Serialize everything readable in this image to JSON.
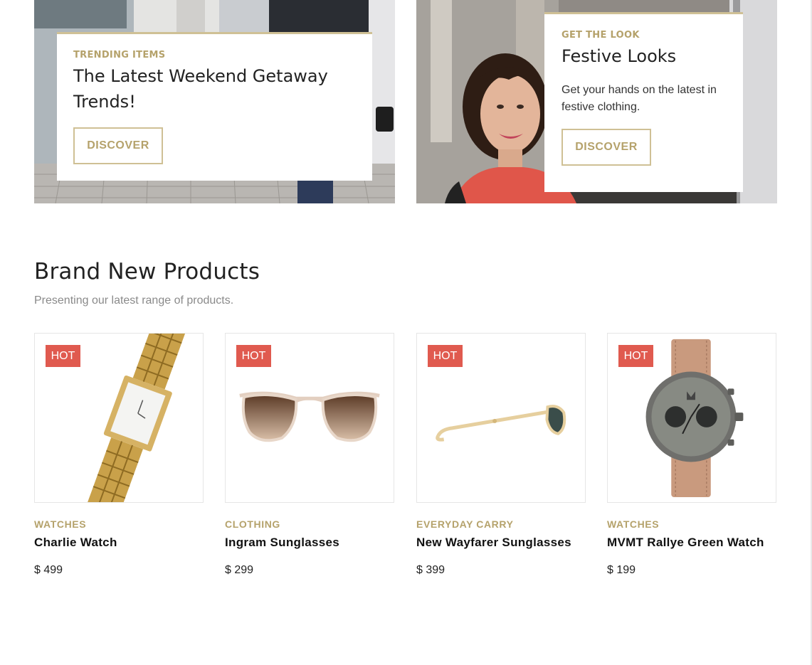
{
  "banners": [
    {
      "eyebrow": "TRENDING ITEMS",
      "title_line1": "The Latest Weekend Getaway",
      "title_line2": "Trends!",
      "description": "",
      "button": "DISCOVER"
    },
    {
      "eyebrow": "GET THE LOOK",
      "title_line1": "Festive Looks",
      "title_line2": "",
      "description": "Get your hands on the latest in festive clothing.",
      "button": "DISCOVER"
    }
  ],
  "section": {
    "title": "Brand New Products",
    "subtitle": "Presenting our latest range of products."
  },
  "products": [
    {
      "badge": "HOT",
      "category": "WATCHES",
      "name": "Charlie Watch",
      "price": "$ 499",
      "image_icon": "gold-watch-image"
    },
    {
      "badge": "HOT",
      "category": "CLOTHING",
      "name": "Ingram Sunglasses",
      "price": "$ 299",
      "image_icon": "sunglasses-image"
    },
    {
      "badge": "HOT",
      "category": "EVERYDAY CARRY",
      "name": "New Wayfarer Sunglasses",
      "price": "$ 399",
      "image_icon": "sunglasses-side-image"
    },
    {
      "badge": "HOT",
      "category": "WATCHES",
      "name": "MVMT Rallye Green Watch",
      "price": "$ 199",
      "image_icon": "chronograph-watch-image"
    }
  ],
  "colors": {
    "accent_gold": "#b5a26b",
    "border_gold": "#cfc095",
    "hot_red": "#e05a4f"
  }
}
